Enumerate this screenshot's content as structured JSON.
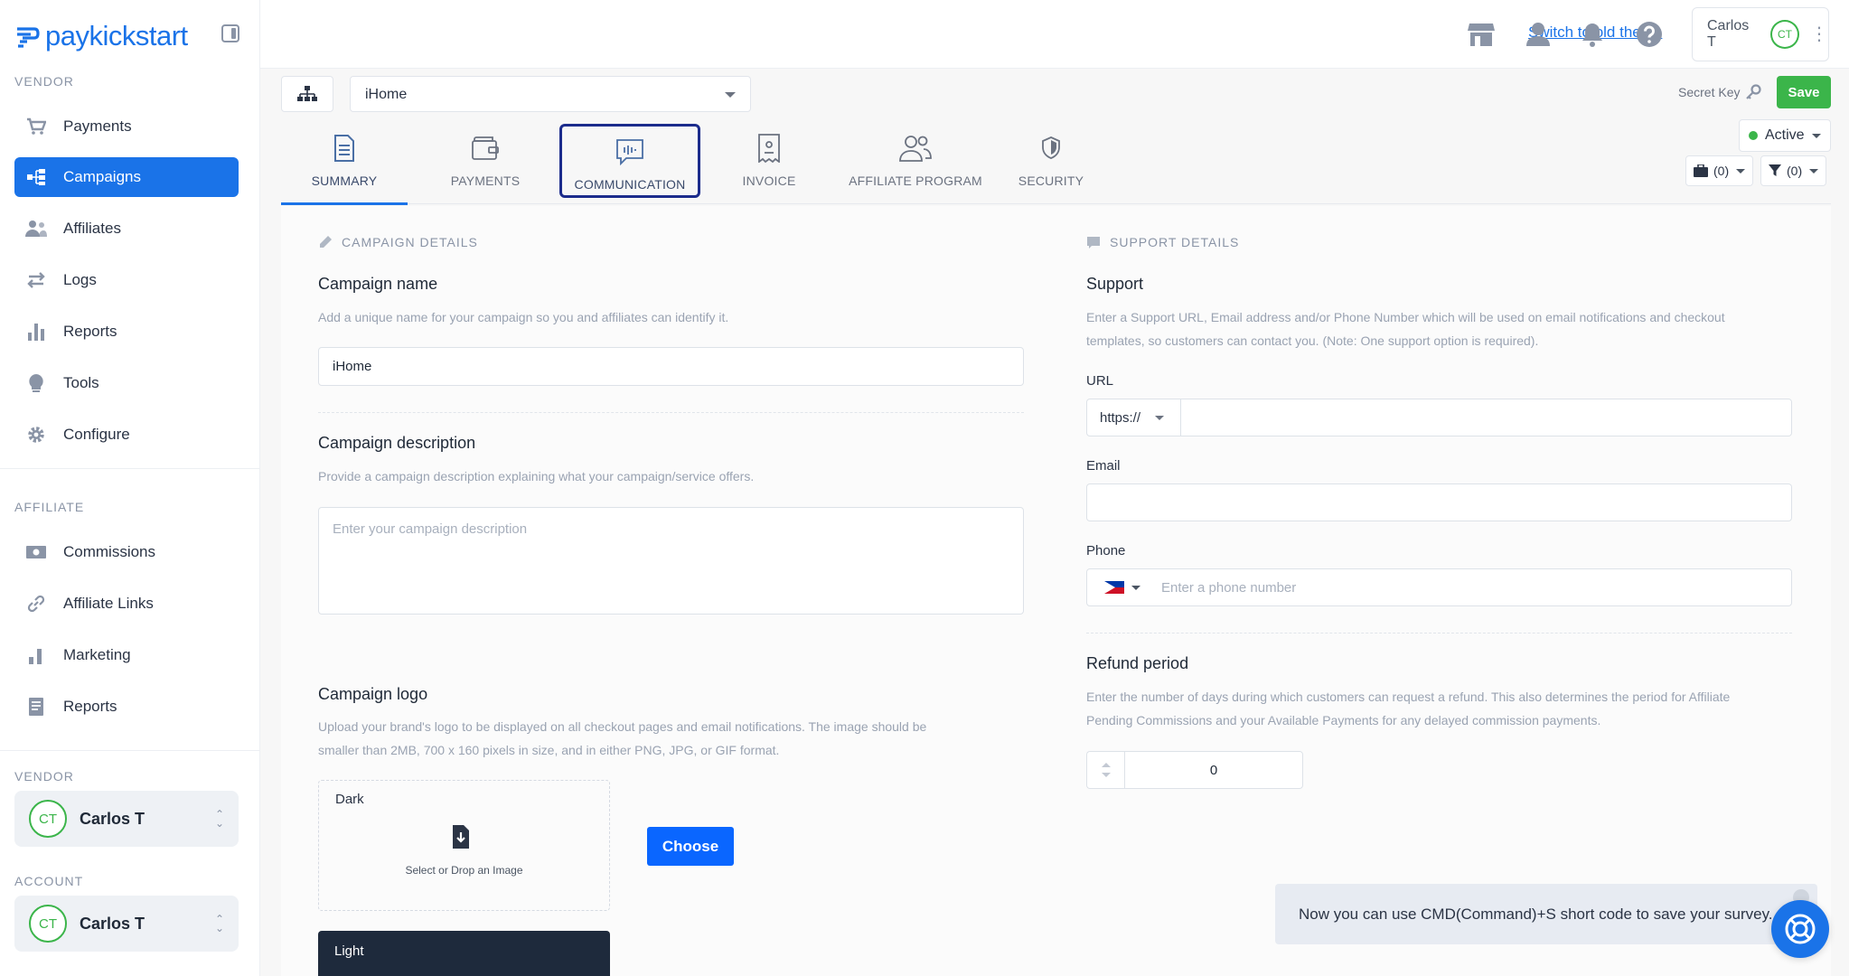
{
  "brand": {
    "name_pay": "pay",
    "name_rest": "kickstart",
    "accent": "#1a73e8",
    "success": "#3bb54a"
  },
  "sidebar": {
    "vendor_label": "VENDOR",
    "vendor_items": [
      {
        "label": "Payments",
        "icon": "cart-icon"
      },
      {
        "label": "Campaigns",
        "icon": "sitemap-icon",
        "active": true
      },
      {
        "label": "Affiliates",
        "icon": "users-icon"
      },
      {
        "label": "Logs",
        "icon": "exchange-icon"
      },
      {
        "label": "Reports",
        "icon": "bar-chart-icon"
      },
      {
        "label": "Tools",
        "icon": "lightbulb-icon"
      },
      {
        "label": "Configure",
        "icon": "gear-icon"
      }
    ],
    "affiliate_label": "AFFILIATE",
    "affiliate_items": [
      {
        "label": "Commissions",
        "icon": "money-icon"
      },
      {
        "label": "Affiliate Links",
        "icon": "link-icon"
      },
      {
        "label": "Marketing",
        "icon": "bar-chart-icon"
      },
      {
        "label": "Reports",
        "icon": "document-icon"
      }
    ],
    "vendor_account_label": "VENDOR",
    "vendor_user": {
      "initials": "CT",
      "name": "Carlos T"
    },
    "account_label": "ACCOUNT",
    "account_user": {
      "initials": "CT",
      "name": "Carlos T"
    }
  },
  "topbar": {
    "switch_theme": "Switch to old theme",
    "icons": [
      "store-icon",
      "user-icon",
      "bell-icon",
      "help-icon"
    ],
    "user": {
      "name": "Carlos T",
      "initials": "CT"
    }
  },
  "campaign": {
    "selected": "iHome",
    "secret_key": "Secret Key",
    "save": "Save",
    "status": "Active",
    "count_a": "(0)",
    "count_b": "(0)"
  },
  "tabs": [
    {
      "label": "SUMMARY",
      "icon": "document-icon",
      "active": true
    },
    {
      "label": "PAYMENTS",
      "icon": "wallet-icon"
    },
    {
      "label": "COMMUNICATION",
      "icon": "chat-icon",
      "focused": true
    },
    {
      "label": "INVOICE",
      "icon": "receipt-icon"
    },
    {
      "label": "AFFILIATE PROGRAM",
      "icon": "people-icon"
    },
    {
      "label": "SECURITY",
      "icon": "shield-icon"
    }
  ],
  "campaign_details": {
    "section": "CAMPAIGN DETAILS",
    "name_label": "Campaign name",
    "name_help": "Add a unique name for your campaign so you and affiliates can identify it.",
    "name_value": "iHome",
    "desc_label": "Campaign description",
    "desc_help": "Provide a campaign description explaining what your campaign/service offers.",
    "desc_placeholder": "Enter your campaign description",
    "logo_label": "Campaign logo",
    "logo_help_1": "Upload your brand's logo to be displayed on all checkout pages and email notifications. The image should be",
    "logo_help_2": "smaller than 2MB, 700 x 160 pixels in size, and in either PNG, JPG, or GIF format.",
    "dark_label": "Dark",
    "upload_text": "Select or Drop an Image",
    "choose": "Choose",
    "light_label": "Light"
  },
  "support_details": {
    "section": "SUPPORT DETAILS",
    "support_label": "Support",
    "support_help_1": "Enter a Support URL, Email address and/or Phone Number which will be used on email notifications and checkout",
    "support_help_2": "templates, so customers can contact you. (Note: One support option is required).",
    "url_label": "URL",
    "url_prefix": "https://",
    "email_label": "Email",
    "phone_label": "Phone",
    "phone_placeholder": "Enter a phone number",
    "refund_label": "Refund period",
    "refund_help_1": "Enter the number of days during which customers can request a refund. This also determines the period for Affiliate",
    "refund_help_2": "Pending Commissions and your Available Payments for any delayed commission payments.",
    "refund_value": "0"
  },
  "toast": {
    "message": "Now you can use CMD(Command)+S short code to save your survey."
  }
}
